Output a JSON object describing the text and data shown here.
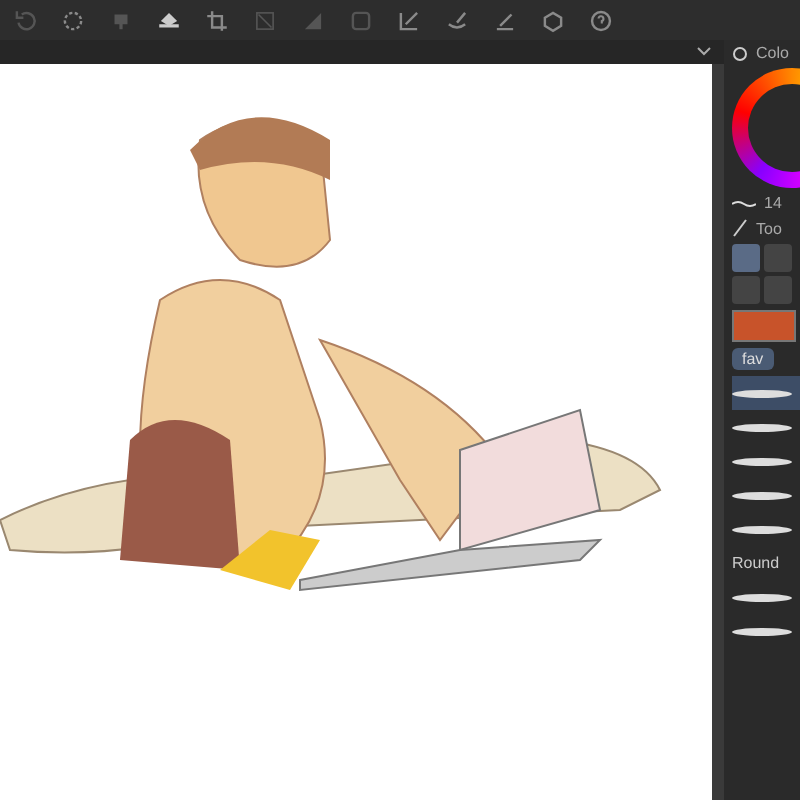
{
  "panel": {
    "color_title": "Colo",
    "brush_size": "14",
    "tool_title": "Too",
    "tools": [
      {
        "selected": true
      },
      {
        "selected": false
      },
      {
        "selected": false
      },
      {
        "selected": false
      }
    ],
    "tabs": [
      {
        "label": "fav",
        "selected": true
      }
    ],
    "brushes": [
      {
        "selected": true
      },
      {
        "selected": false
      },
      {
        "selected": false
      },
      {
        "selected": false
      },
      {
        "selected": false
      },
      {
        "label": "Round",
        "selected": false
      },
      {
        "selected": false
      },
      {
        "selected": false
      }
    ]
  }
}
